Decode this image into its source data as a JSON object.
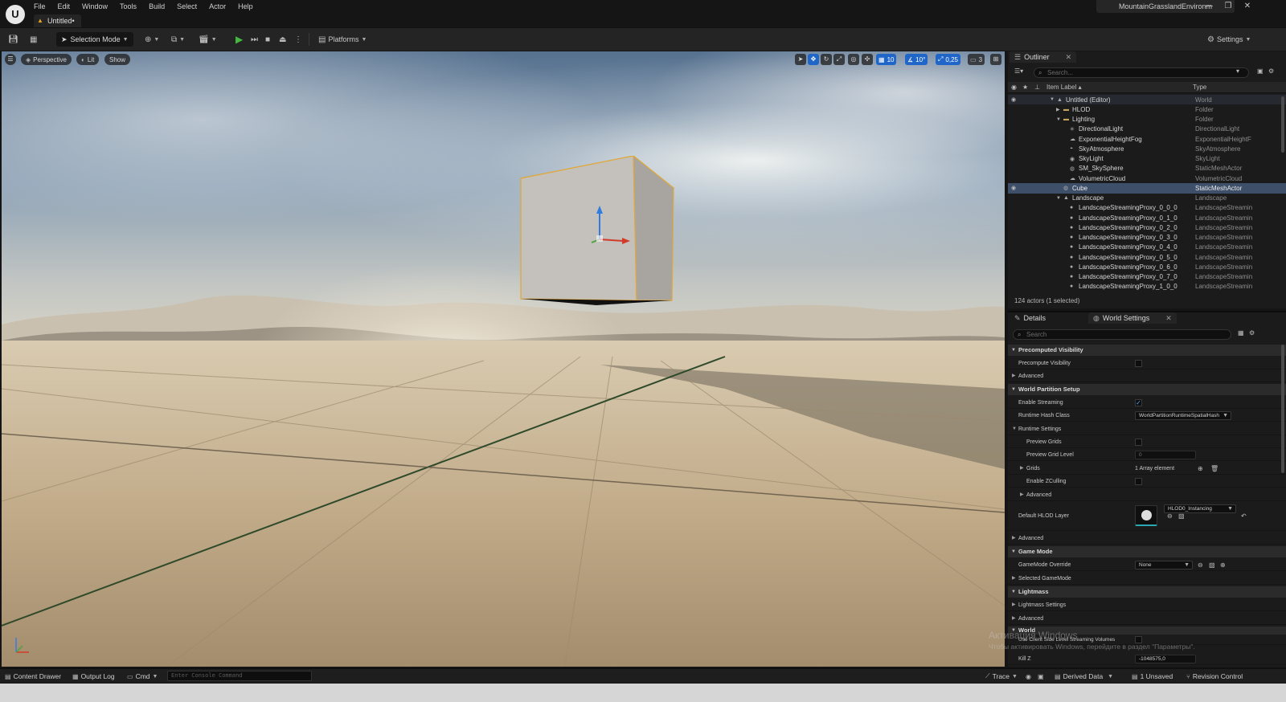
{
  "window": {
    "project_name": "MountainGrasslandEnvironm",
    "document_tab": "Untitled•",
    "logo_text": "U",
    "controls": [
      "—",
      "❐",
      "✕"
    ]
  },
  "menu": [
    "File",
    "Edit",
    "Window",
    "Tools",
    "Build",
    "Select",
    "Actor",
    "Help"
  ],
  "toolbar": {
    "mode_label": "Selection Mode",
    "platforms_label": "Platforms",
    "settings_label": "Settings"
  },
  "viewport": {
    "perspective_label": "Perspective",
    "lit_label": "Lit",
    "show_label": "Show",
    "grid_snap": "10",
    "rotation_snap": "10°",
    "scale_snap": "0,25",
    "camera_speed": "3"
  },
  "outliner": {
    "tab_label": "Outliner",
    "search_placeholder": "Search...",
    "col_label": "Item Label ▴",
    "col_type": "Type",
    "status": "124 actors (1 selected)",
    "rows": [
      {
        "label": "Untitled (Editor)",
        "type": "World",
        "icon": "▲",
        "indent": 0,
        "arrow": "▼",
        "highlight": true
      },
      {
        "label": "HLOD",
        "type": "Folder",
        "icon": "▬",
        "indent": 1,
        "arrow": "▶"
      },
      {
        "label": "Lighting",
        "type": "Folder",
        "icon": "▬",
        "indent": 1,
        "arrow": "▼"
      },
      {
        "label": "DirectionalLight",
        "type": "DirectionalLight",
        "icon": "✳",
        "indent": 2,
        "arrow": ""
      },
      {
        "label": "ExponentialHeightFog",
        "type": "ExponentialHeightF",
        "icon": "☁",
        "indent": 2,
        "arrow": ""
      },
      {
        "label": "SkyAtmosphere",
        "type": "SkyAtmosphere",
        "icon": "◓",
        "indent": 2,
        "arrow": ""
      },
      {
        "label": "SkyLight",
        "type": "SkyLight",
        "icon": "◉",
        "indent": 2,
        "arrow": ""
      },
      {
        "label": "SM_SkySphere",
        "type": "StaticMeshActor",
        "icon": "◍",
        "indent": 2,
        "arrow": ""
      },
      {
        "label": "VolumetricCloud",
        "type": "VolumetricCloud",
        "icon": "☁",
        "indent": 2,
        "arrow": ""
      },
      {
        "label": "Cube",
        "type": "StaticMeshActor",
        "icon": "◍",
        "indent": 1,
        "arrow": "",
        "selected": true
      },
      {
        "label": "Landscape",
        "type": "Landscape",
        "icon": "▲",
        "indent": 1,
        "arrow": "▼"
      },
      {
        "label": "LandscapeStreamingProxy_0_0_0",
        "type": "LandscapeStreamin",
        "icon": "●",
        "indent": 2,
        "arrow": ""
      },
      {
        "label": "LandscapeStreamingProxy_0_1_0",
        "type": "LandscapeStreamin",
        "icon": "●",
        "indent": 2,
        "arrow": ""
      },
      {
        "label": "LandscapeStreamingProxy_0_2_0",
        "type": "LandscapeStreamin",
        "icon": "●",
        "indent": 2,
        "arrow": ""
      },
      {
        "label": "LandscapeStreamingProxy_0_3_0",
        "type": "LandscapeStreamin",
        "icon": "●",
        "indent": 2,
        "arrow": ""
      },
      {
        "label": "LandscapeStreamingProxy_0_4_0",
        "type": "LandscapeStreamin",
        "icon": "●",
        "indent": 2,
        "arrow": ""
      },
      {
        "label": "LandscapeStreamingProxy_0_5_0",
        "type": "LandscapeStreamin",
        "icon": "●",
        "indent": 2,
        "arrow": ""
      },
      {
        "label": "LandscapeStreamingProxy_0_6_0",
        "type": "LandscapeStreamin",
        "icon": "●",
        "indent": 2,
        "arrow": ""
      },
      {
        "label": "LandscapeStreamingProxy_0_7_0",
        "type": "LandscapeStreamin",
        "icon": "●",
        "indent": 2,
        "arrow": ""
      },
      {
        "label": "LandscapeStreamingProxy_1_0_0",
        "type": "LandscapeStreamin",
        "icon": "●",
        "indent": 2,
        "arrow": ""
      }
    ]
  },
  "details": {
    "tab_details": "Details",
    "tab_world_settings": "World Settings",
    "search_placeholder": "Search",
    "sections": {
      "precomputed_visibility": "Precomputed Visibility",
      "world_partition_setup": "World Partition Setup",
      "game_mode": "Game Mode",
      "lightmass": "Lightmass",
      "world": "World"
    },
    "props": {
      "precompute_visibility": "Precompute Visibility",
      "advanced": "Advanced",
      "enable_streaming": "Enable Streaming",
      "runtime_hash_class": "Runtime Hash Class",
      "runtime_hash_value": "WorldPartitionRuntimeSpatialHash",
      "runtime_settings": "Runtime Settings",
      "preview_grids": "Preview Grids",
      "preview_grid_level": "Preview Grid Level",
      "preview_grid_level_value": "0",
      "grids": "Grids",
      "grids_value": "1 Array element",
      "enable_zculling": "Enable ZCulling",
      "default_hlod_layer": "Default HLOD Layer",
      "default_hlod_value": "HLOD0_Instancing",
      "gamemode_override": "GameMode Override",
      "gamemode_value": "None",
      "selected_gamemode": "Selected GameMode",
      "lightmass_settings": "Lightmass Settings",
      "use_client_side": "Use Client Side Level Streaming Volumes",
      "kill_z": "Kill Z",
      "kill_z_value": "-1048575,0"
    },
    "checked": "✓"
  },
  "statusbar": {
    "content_drawer": "Content Drawer",
    "output_log": "Output Log",
    "cmd": "Cmd",
    "console_placeholder": "Enter Console Command",
    "trace": "Trace",
    "derived_data": "Derived Data",
    "unsaved": "1 Unsaved",
    "revision_control": "Revision Control"
  },
  "watermark": {
    "line1": "Активация Windows",
    "line2": "Чтобы активировать Windows, перейдите в раздел \"Параметры\"."
  }
}
